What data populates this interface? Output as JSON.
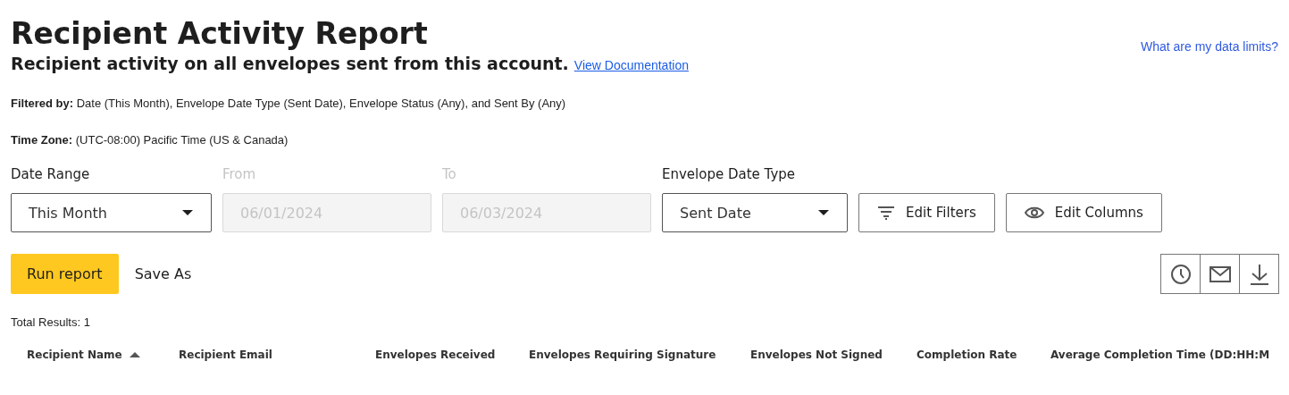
{
  "title": "Recipient Activity Report",
  "subtitle": "Recipient activity on all envelopes sent from this account.",
  "documentation_link": "View Documentation",
  "data_limits_link": "What are my data limits?",
  "filtered_by": "**Filtered by:** Date (This Month), Envelope Date Type (Sent Date), Envelope Status (Any), and Sent By (Any)",
  "time_zone": "**Time Zone:** (UTC-08:00) Pacific Time (US & Canada)",
  "filters": [
    {
      "kind": "select",
      "label": "Date Range",
      "value": "This Month",
      "disabled": false
    },
    {
      "kind": "date",
      "label": "From",
      "value": "06/01/2024",
      "disabled": true
    },
    {
      "kind": "date",
      "label": "To",
      "value": "06/03/2024",
      "disabled": true
    },
    {
      "kind": "select",
      "label": "Envelope Date Type",
      "value": "Sent Date",
      "disabled": false
    }
  ],
  "filter_buttons": [
    {
      "kind": "filter",
      "label": "Edit Filters"
    },
    {
      "kind": "eye",
      "label": "Edit Columns"
    }
  ],
  "run_button": "Run report",
  "save_button": "Save As",
  "icon_buttons": [
    {
      "kind": "clock"
    },
    {
      "kind": "mail"
    },
    {
      "kind": "download"
    }
  ],
  "total_results": "Total Results: 1",
  "table": {
    "columns": [
      {
        "label": "Recipient Name",
        "sorted": true
      },
      {
        "label": "Recipient Email",
        "sorted": false
      },
      {
        "label": "Envelopes Received",
        "sorted": false
      },
      {
        "label": "Envelopes Requiring Signature",
        "sorted": false
      },
      {
        "label": "Envelopes Not Signed",
        "sorted": false
      },
      {
        "label": "Completion Rate",
        "sorted": false
      },
      {
        "label": "Average Completion Time (DD:HH:M",
        "sorted": false
      }
    ]
  }
}
